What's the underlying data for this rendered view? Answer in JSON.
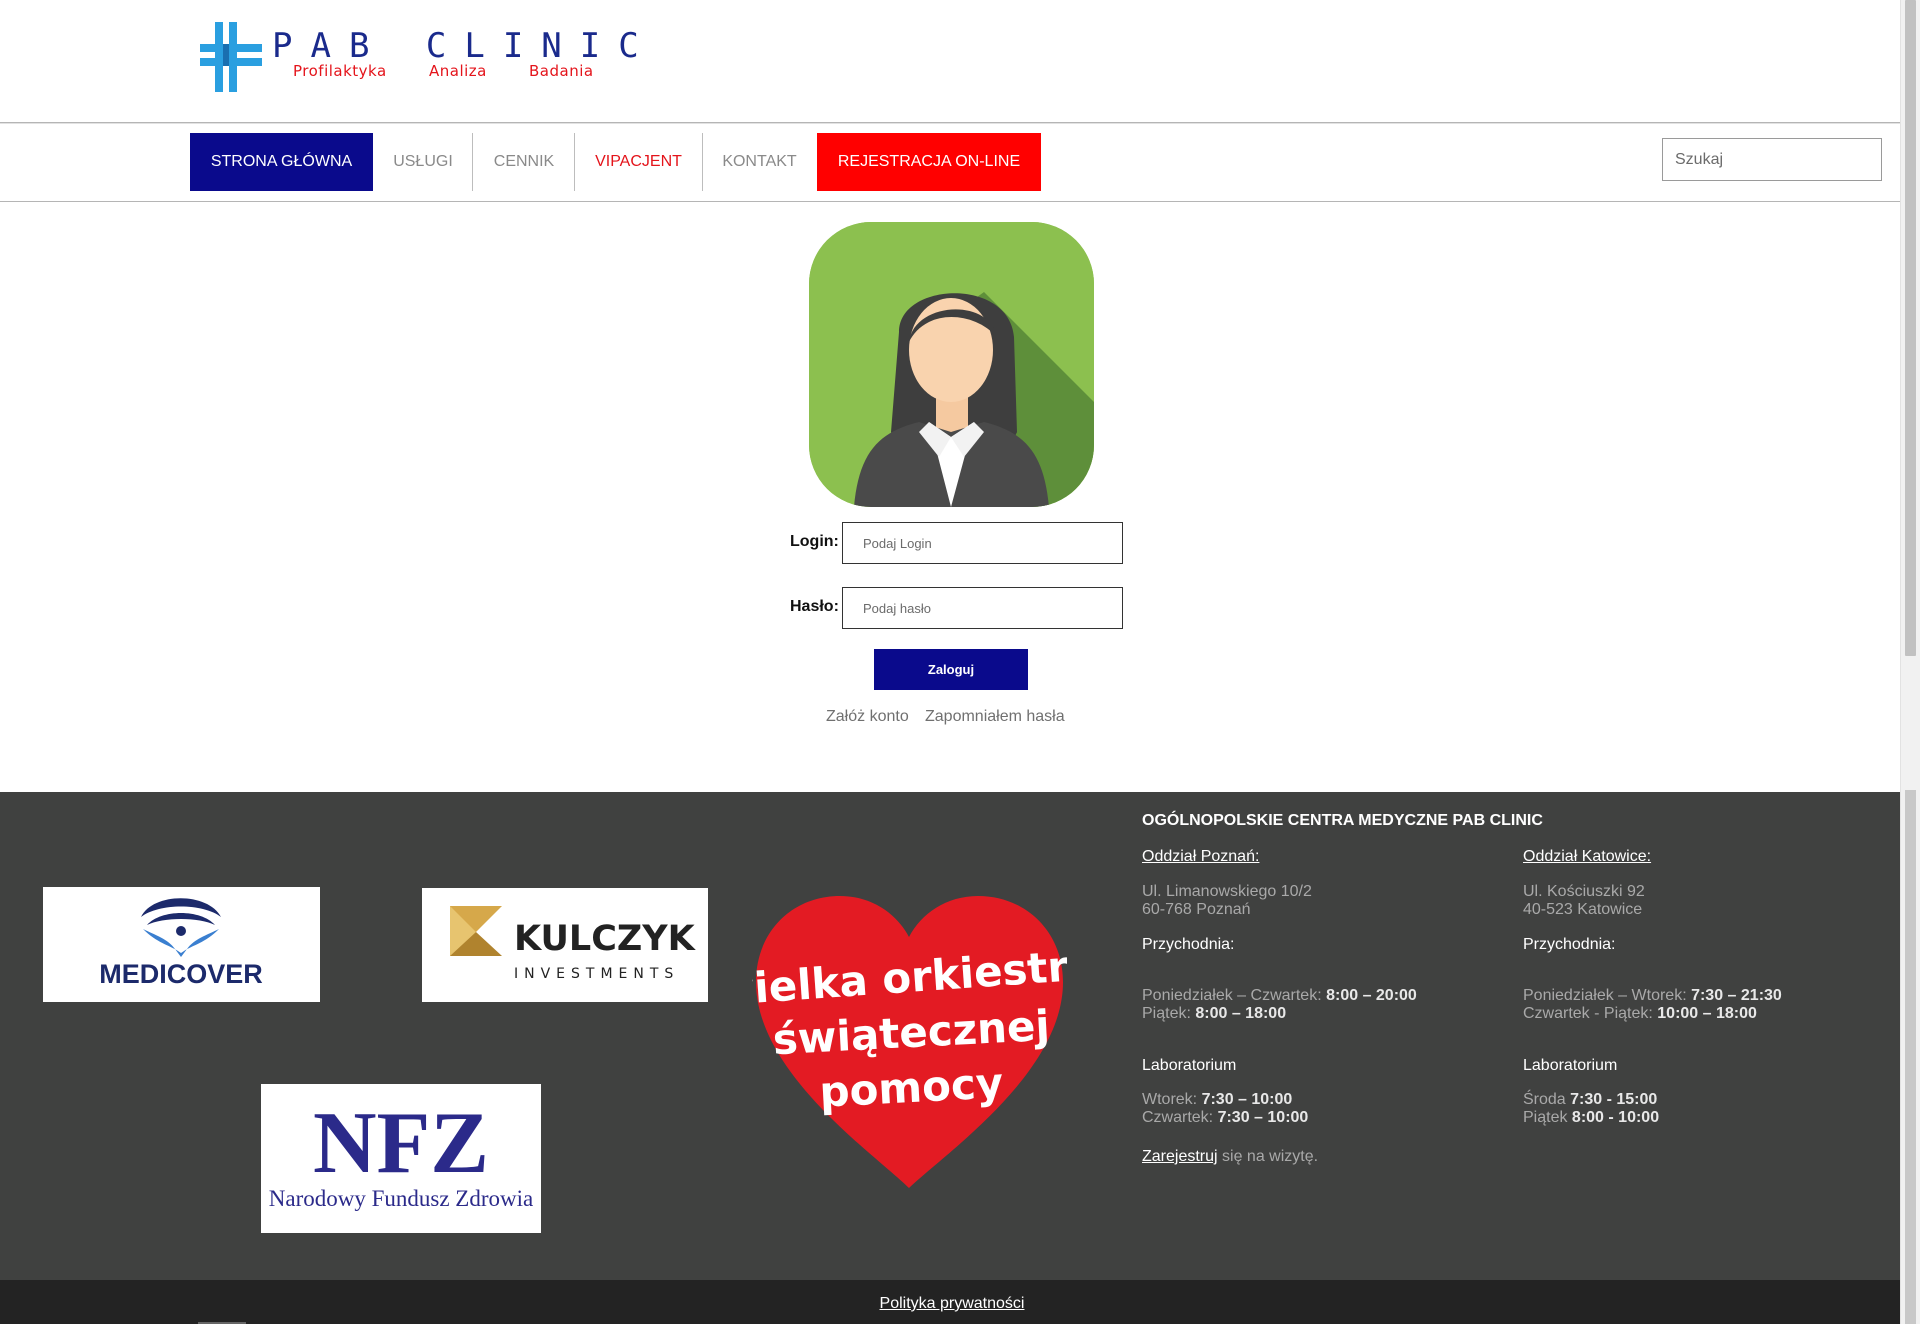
{
  "brand": {
    "name": "PAB CLINIC",
    "tagline": [
      "Profilaktyka",
      "Analiza",
      "Badania"
    ]
  },
  "nav": {
    "items": [
      {
        "label": "STRONA GŁÓWNA",
        "active": true
      },
      {
        "label": "USŁUGI"
      },
      {
        "label": "CENNIK"
      },
      {
        "label": "VIPACJENT"
      },
      {
        "label": "KONTAKT"
      },
      {
        "label": "REJESTRACJA ON-LINE"
      }
    ],
    "search_placeholder": "Szukaj"
  },
  "login": {
    "login_label": "Login:",
    "login_placeholder": "Podaj Login",
    "password_label": "Hasło:",
    "password_placeholder": "Podaj hasło",
    "submit_label": "Zaloguj",
    "register_link": "Załóż konto",
    "forgot_link": "Zapomniałem hasła"
  },
  "sponsors": {
    "medicover": "MEDICOVER",
    "kulczyk_top": "KULCZYK",
    "kulczyk_bottom": "INVESTMENTS",
    "nfz_top": "NFZ",
    "nfz_bottom": "Narodowy Fundusz Zdrowia",
    "wosp": [
      "wielka orkiestra",
      "świątecznej",
      "pomocy"
    ]
  },
  "footer": {
    "title": "OGÓLNOPOLSKIE CENTRA MEDYCZNE PAB CLINIC",
    "poznan": {
      "heading": "Oddział Poznań:",
      "address": [
        "Ul. Limanowskiego 10/2",
        "60-768 Poznań"
      ],
      "clinic_heading": "Przychodnia:",
      "hours": [
        {
          "days": "Poniedziałek – Czwartek: ",
          "time": "8:00 – 20:00"
        },
        {
          "days": "Piątek: ",
          "time": "8:00 – 18:00"
        }
      ],
      "lab_heading": "Laboratorium",
      "lab_hours": [
        {
          "days": "Wtorek: ",
          "time": "7:30 – 10:00"
        },
        {
          "days": "Czwartek: ",
          "time": "7:30 – 10:00"
        }
      ],
      "register_link": "Zarejestruj",
      "register_text": " się na wizytę."
    },
    "katowice": {
      "heading": "Oddział Katowice:",
      "address": [
        "Ul. Kościuszki 92",
        "40-523 Katowice"
      ],
      "clinic_heading": "Przychodnia:",
      "hours": [
        {
          "days": "Poniedziałek – Wtorek: ",
          "time": "7:30 – 21:30"
        },
        {
          "days": "Czwartek - Piątek: ",
          "time": "10:00 – 18:00"
        }
      ],
      "lab_heading": "Laboratorium",
      "lab_hours": [
        {
          "days": "Środa ",
          "time": "7:30 - 15:00"
        },
        {
          "days": "Piątek ",
          "time": "8:00 - 10:00"
        }
      ]
    },
    "privacy_link": "Polityka prywatności"
  },
  "colors": {
    "navy": "#0a0a8c",
    "red": "#ff0000",
    "footer_bg": "#404140",
    "footer_bar": "#232323",
    "avatar_green": "#8cc04f"
  }
}
